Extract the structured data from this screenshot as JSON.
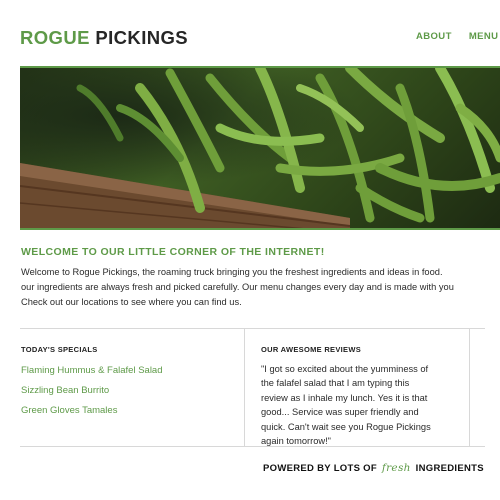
{
  "header": {
    "brand_part1": "ROGUE",
    "brand_part2": "PICKINGS",
    "nav": [
      "ABOUT",
      "MENU"
    ]
  },
  "hero": {
    "image": "green-beans-photo"
  },
  "welcome": {
    "title": "WELCOME TO OUR LITTLE CORNER OF THE INTERNET!",
    "lines": [
      "Welcome to Rogue Pickings, the roaming truck bringing you the freshest ingredients and ideas in food.",
      "our ingredients are always fresh and picked carefully. Our menu changes every day and is made with you",
      "Check out our locations to see where you can find us."
    ]
  },
  "specials": {
    "title": "TODAY'S SPECIALS",
    "items": [
      "Flaming Hummus & Falafel Salad",
      "Sizzling Bean Burrito",
      "Green Gloves Tamales"
    ]
  },
  "reviews": {
    "title": "OUR AWESOME REVIEWS",
    "lines": [
      "\"I got so excited about the yumminess of",
      "the falafel salad that I am typing this",
      "review as I inhale my lunch. Yes it is that",
      "good... Service was super friendly and",
      "quick. Can't wait see you Rogue Pickings",
      "again tomorrow!\""
    ]
  },
  "footer": {
    "prefix": "POWERED BY LOTS OF",
    "script": "fresh",
    "suffix": "INGREDIENTS"
  },
  "colors": {
    "accent": "#5e9a48",
    "text": "#2b2b2b"
  }
}
